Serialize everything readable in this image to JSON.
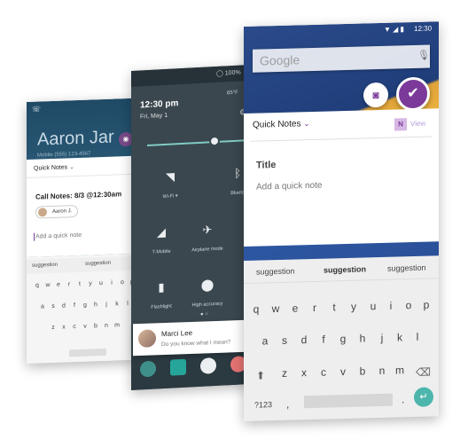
{
  "phone_left": {
    "contact_name": "Aaron Jar",
    "mobile_line": "Mobile (555) 123-4567",
    "quick_notes_label": "Quick Notes",
    "call_notes": "Call Notes: 8/3 @12:30am",
    "chip_name": "Aaron J.",
    "quick_note_placeholder": "Add a quick note",
    "suggestions": [
      "suggestion",
      "suggestion"
    ],
    "keyboard_rows": [
      [
        "q",
        "w",
        "e",
        "r",
        "t",
        "y",
        "u",
        "i",
        "o",
        "p"
      ],
      [
        "a",
        "s",
        "d",
        "f",
        "g",
        "h",
        "j",
        "k",
        "l"
      ],
      [
        "z",
        "x",
        "c",
        "v",
        "b",
        "n",
        "m"
      ]
    ]
  },
  "phone_middle": {
    "battery": "100%",
    "time": "12:30 pm",
    "date": "Fri, May 1",
    "temp": "65°F",
    "tiles": [
      {
        "label": "Wi-Fi ▾",
        "icon": "wifi-icon"
      },
      {
        "label": "Blueto",
        "icon": "bluetooth-icon"
      },
      {
        "label": "T-Mobile",
        "icon": "signal-icon"
      },
      {
        "label": "Airplane mode",
        "icon": "airplane-icon"
      },
      {
        "label": "Flashlight",
        "icon": "flashlight-icon"
      },
      {
        "label": "High accuracy",
        "icon": "location-icon"
      }
    ],
    "notification": {
      "name": "Marci Lee",
      "message": "Do you know what I mean?"
    }
  },
  "phone_right": {
    "time": "12:30",
    "search_logo": "Google",
    "quick_notes_label": "Quick Notes",
    "view_label": "View",
    "title_label": "Title",
    "quick_note_placeholder": "Add a quick note",
    "suggestions": [
      "suggestion",
      "suggestion",
      "suggestion"
    ],
    "keyboard_rows": [
      [
        "q",
        "w",
        "e",
        "r",
        "t",
        "y",
        "u",
        "i",
        "o",
        "p"
      ],
      [
        "a",
        "s",
        "d",
        "f",
        "g",
        "h",
        "j",
        "k",
        "l"
      ],
      [
        "z",
        "x",
        "c",
        "v",
        "b",
        "n",
        "m"
      ]
    ],
    "key_123": "?123",
    "key_comma": ",",
    "key_dot": ".",
    "accent_color": "#7b3a99",
    "enter_color": "#4db6ac"
  }
}
